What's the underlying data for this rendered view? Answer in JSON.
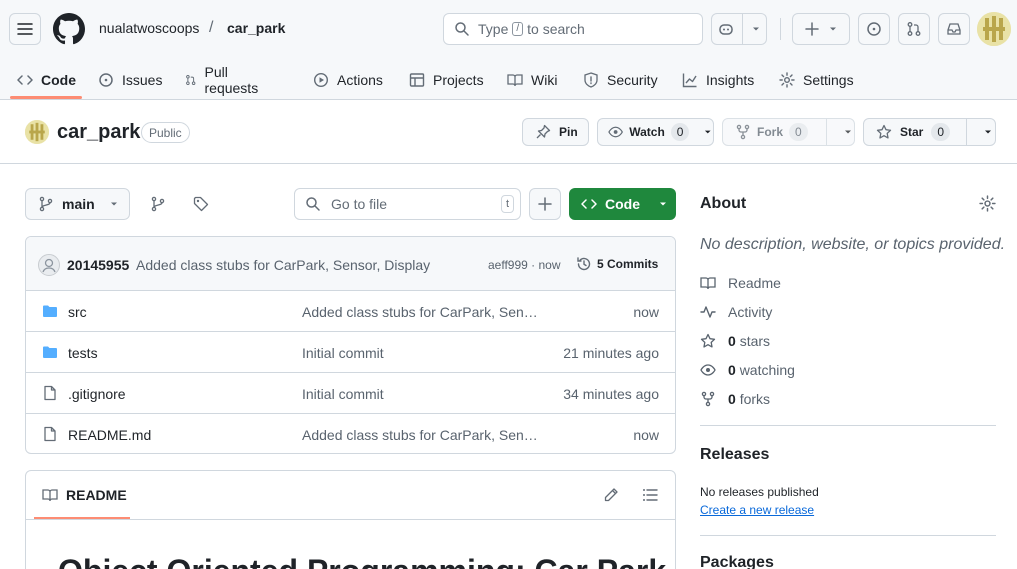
{
  "header": {
    "owner": "nualatwoscoops",
    "separator": "/",
    "repo": "car_park",
    "search_prefix": "Type",
    "search_key": "/",
    "search_suffix": "to search"
  },
  "nav_tabs": [
    {
      "label": "Code",
      "icon": "code-icon"
    },
    {
      "label": "Issues",
      "icon": "issue-icon"
    },
    {
      "label": "Pull requests",
      "icon": "pull-request-icon"
    },
    {
      "label": "Actions",
      "icon": "play-icon"
    },
    {
      "label": "Projects",
      "icon": "table-icon"
    },
    {
      "label": "Wiki",
      "icon": "book-icon"
    },
    {
      "label": "Security",
      "icon": "shield-icon"
    },
    {
      "label": "Insights",
      "icon": "graph-icon"
    },
    {
      "label": "Settings",
      "icon": "gear-icon"
    }
  ],
  "repo_header": {
    "name": "car_park",
    "visibility": "Public",
    "pin_label": "Pin",
    "watch_label": "Watch",
    "watch_count": "0",
    "fork_label": "Fork",
    "fork_count": "0",
    "star_label": "Star",
    "star_count": "0"
  },
  "toolbar": {
    "branch": "main",
    "goto_placeholder": "Go to file",
    "goto_key": "t",
    "code_label": "Code"
  },
  "latest_commit": {
    "author": "20145955",
    "message": "Added class stubs for CarPark, Sensor, Display",
    "hash_time": "aeff999 · now",
    "commits_label": "5 Commits"
  },
  "files": [
    {
      "type": "folder",
      "name": "src",
      "message": "Added class stubs for CarPark, Sensor, Display",
      "time": "now"
    },
    {
      "type": "folder",
      "name": "tests",
      "message": "Initial commit",
      "time": "21 minutes ago"
    },
    {
      "type": "file",
      "name": ".gitignore",
      "message": "Initial commit",
      "time": "34 minutes ago"
    },
    {
      "type": "file",
      "name": "README.md",
      "message": "Added class stubs for CarPark, Sensor, Display",
      "time": "now"
    }
  ],
  "readme": {
    "tab_label": "README",
    "title": "Object Oriented Programming: Car Park"
  },
  "about": {
    "title": "About",
    "description": "No description, website, or topics provided.",
    "readme_label": "Readme",
    "activity_label": "Activity",
    "stars_count": "0",
    "stars_label": "stars",
    "watching_count": "0",
    "watching_label": "watching",
    "forks_count": "0",
    "forks_label": "forks"
  },
  "releases": {
    "title": "Releases",
    "none_text": "No releases published",
    "create_link": "Create a new release"
  },
  "packages": {
    "title": "Packages"
  },
  "colors": {
    "accent_green": "#1f883d",
    "link_blue": "#0969da",
    "tab_underline": "#fd8c73",
    "folder_blue": "#54aeff"
  }
}
